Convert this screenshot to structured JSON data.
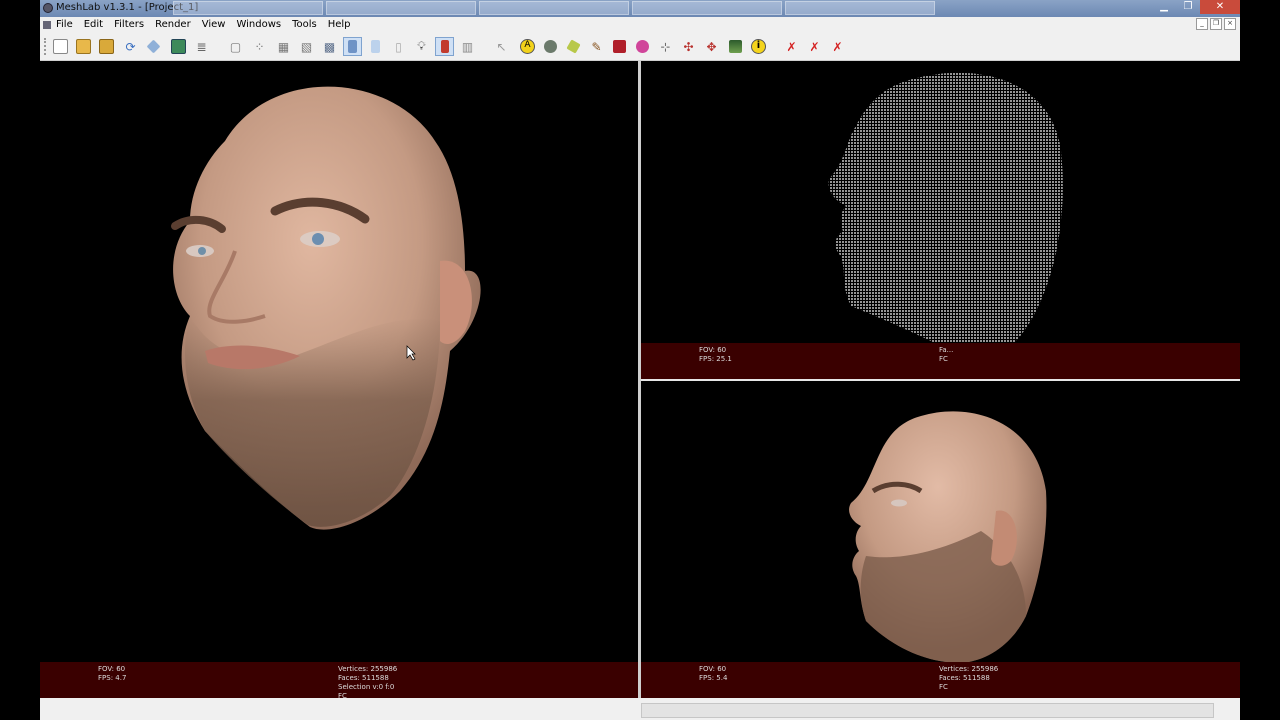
{
  "window": {
    "title": "MeshLab v1.3.1 - [Project_1]",
    "taskbar_ghosts": [
      "",
      "",
      "",
      "",
      ""
    ]
  },
  "menu": {
    "items": [
      "File",
      "Edit",
      "Filters",
      "Render",
      "View",
      "Windows",
      "Tools",
      "Help"
    ]
  },
  "toolbar": {
    "icons": [
      "new-file-icon",
      "open-folder-icon",
      "open-project-icon",
      "reload-icon",
      "import-mesh-icon",
      "snapshot-icon",
      "layers-icon",
      "bounding-box-icon",
      "points-render-icon",
      "wireframe-icon",
      "hidden-lines-icon",
      "flat-lines-icon",
      "flat-icon",
      "smooth-icon",
      "texture-icon",
      "light-icon",
      "double-side-icon",
      "back-face-icon",
      "select-icon",
      "annotation-icon",
      "measure-icon",
      "paint-icon",
      "brush-icon",
      "color-icon",
      "z-paint-icon",
      "align-icon",
      "manipulator-icon",
      "point-picker-icon",
      "texture-map-icon",
      "info-icon",
      "delete-selected-icon",
      "delete-faces-icon",
      "delete-vertices-icon"
    ]
  },
  "views": {
    "main": {
      "fov": "FOV: 60",
      "fps": "FPS:   4.7",
      "vertices": "Vertices: 255986",
      "faces": "Faces: 511588",
      "selection": "Selection v:0 f:0",
      "mode": "FC"
    },
    "top_right": {
      "fov": "FOV: 60",
      "fps": "FPS:   25.1",
      "vertices": "Fa...",
      "mode": "FC"
    },
    "bottom_right": {
      "fov": "FOV: 60",
      "fps": "FPS:   5.4",
      "vertices": "Vertices: 255986",
      "faces": "Faces: 511588",
      "mode": "FC"
    }
  },
  "colors": {
    "info_bar": "#3a0000",
    "skin": "#c9a08a",
    "beard": "#7a5a46"
  }
}
